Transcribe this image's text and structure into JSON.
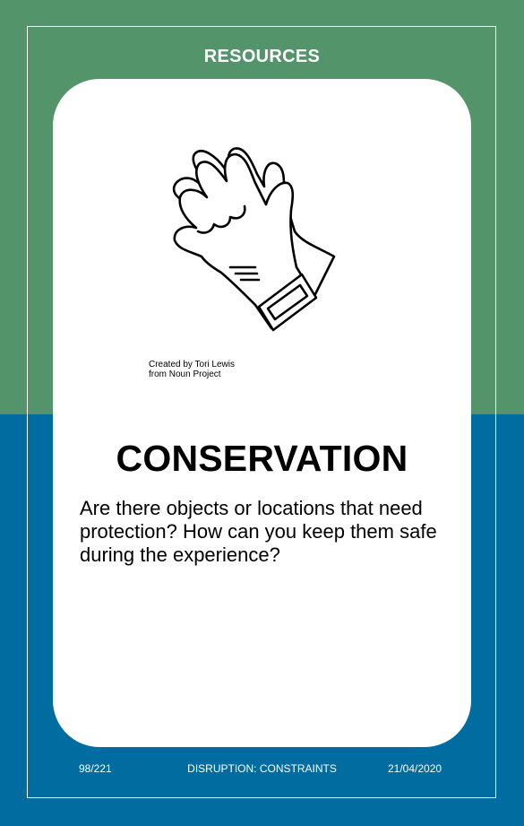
{
  "card": {
    "category": "RESOURCES",
    "title": "CONSERVATION",
    "prompt": "Are there objects or locations that need protection? How can you keep them safe during the experience?",
    "icon": "gloves-icon",
    "credit_line1": "Created by Tori Lewis",
    "credit_line2": "from Noun Project"
  },
  "footer": {
    "page": "98/221",
    "section": "DISRUPTION: CONSTRAINTS",
    "date": "21/04/2020"
  },
  "colors": {
    "top_band": "#54946a",
    "bottom_band": "#006c9f",
    "card": "#ffffff"
  }
}
